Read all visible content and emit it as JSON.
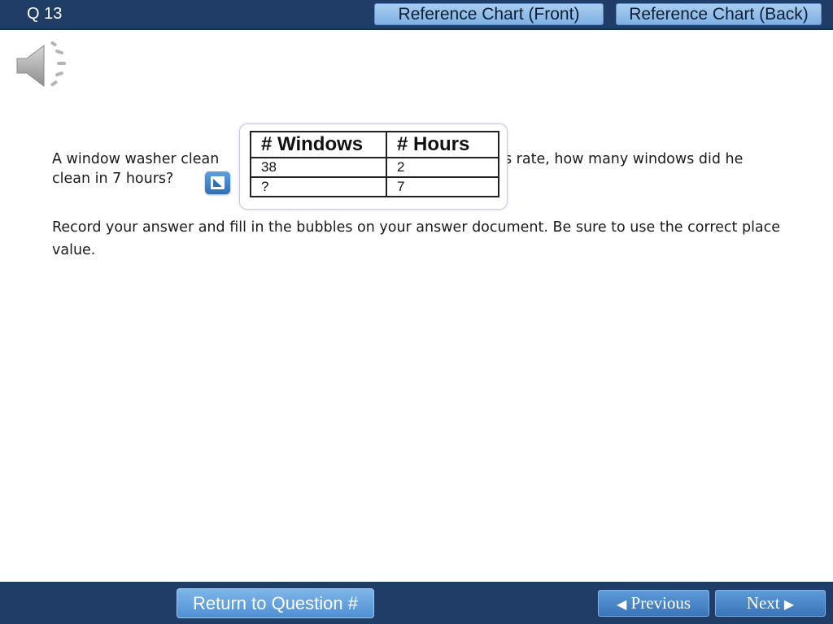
{
  "header": {
    "question_number": "Q 13",
    "buttons": {
      "reference_front": "Reference Chart (Front)",
      "reference_back": "Reference Chart (Back)"
    }
  },
  "audio": {
    "icon": "speaker-icon"
  },
  "question": {
    "line1_start": "A window washer clean",
    "line1_end": "s rate, how many windows did he",
    "line2": "clean in 7 hours?",
    "instructions": "Record your answer and fill in the bubbles on your answer document. Be sure to use the correct place value."
  },
  "table_popup": {
    "headers": [
      "# Windows",
      "# Hours"
    ],
    "rows": [
      [
        "38",
        "2"
      ],
      [
        "?",
        "7"
      ]
    ]
  },
  "footer": {
    "return_label": "Return to Question #",
    "previous_label": "Previous",
    "next_label": "Next",
    "previous_icon": "triangle-left-icon",
    "next_icon": "triangle-right-icon"
  },
  "colors": {
    "bar": "#1f3d66",
    "button_light": "#a9cdf0",
    "button_nav": "#4f8fd2"
  }
}
